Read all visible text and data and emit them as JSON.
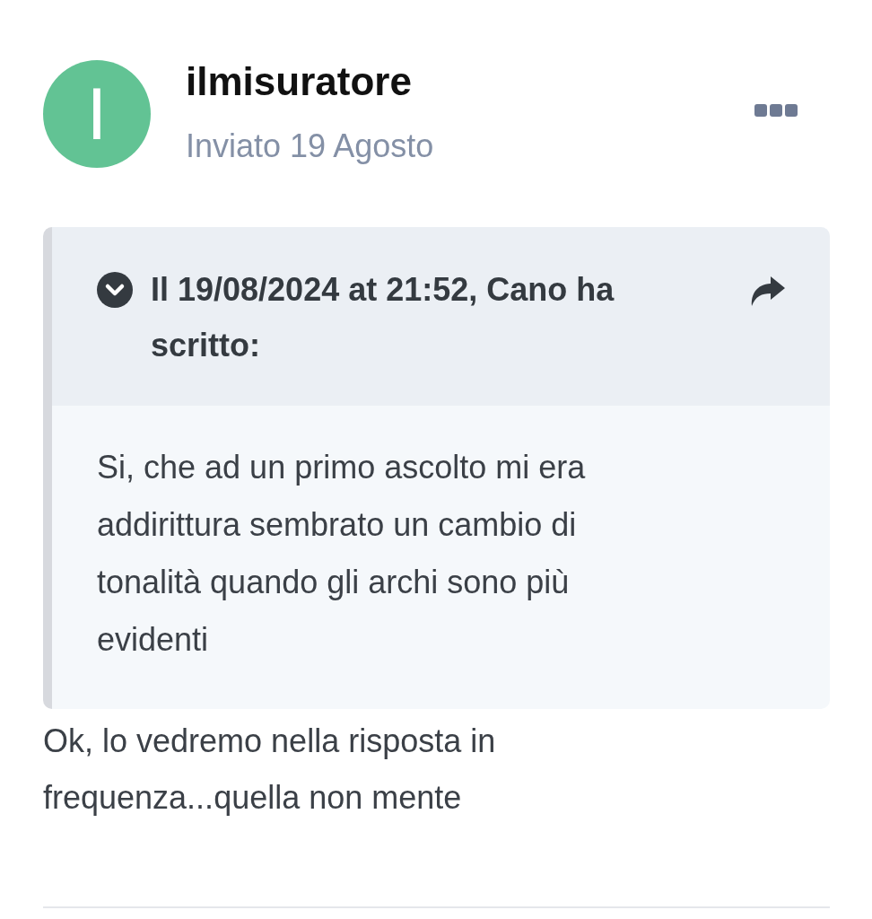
{
  "post": {
    "author": {
      "name": "ilmisuratore",
      "avatar_letter": "I"
    },
    "sent": "Inviato 19 Agosto"
  },
  "quote": {
    "header": "Il 19/08/2024 at 21:52, Cano ha scritto:",
    "body": "Si, che ad un primo ascolto mi era addirittura sembrato un cambio di tonalità quando gli archi sono più evidenti"
  },
  "reply": "Ok, lo vedremo nella risposta in frequenza...quella non mente"
}
